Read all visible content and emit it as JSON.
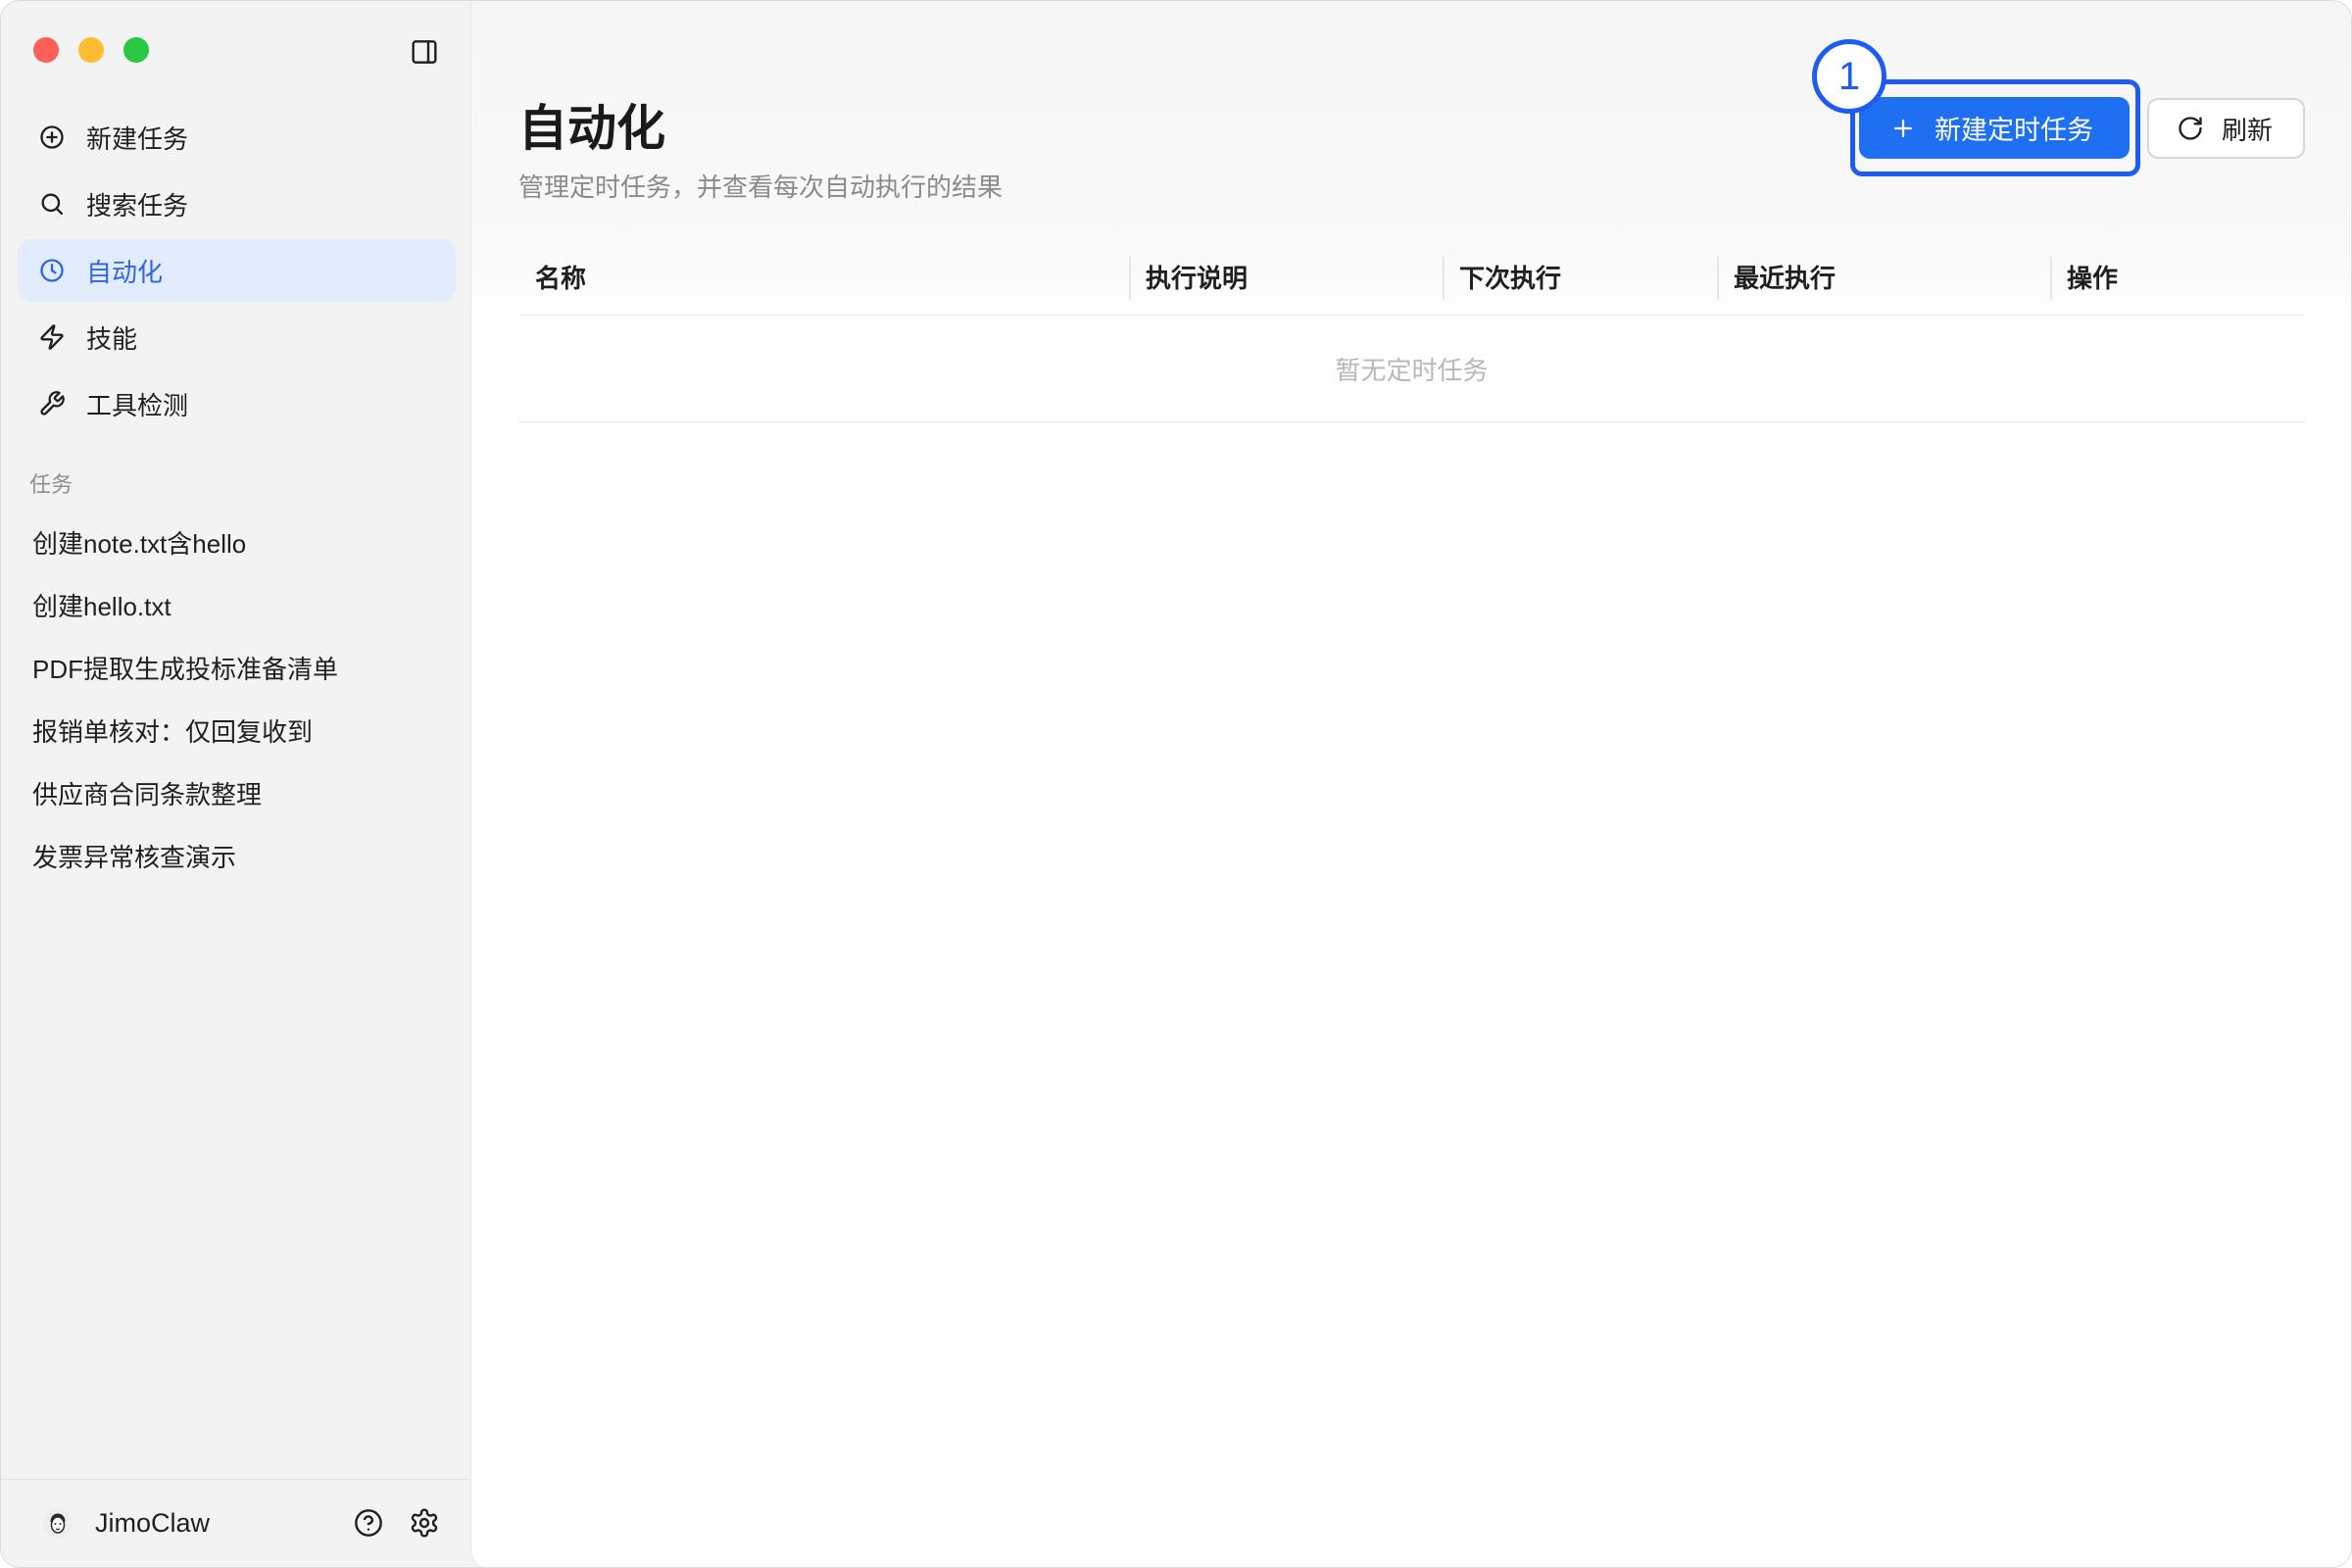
{
  "sidebar": {
    "toggle_icon": "sidebar-toggle-icon",
    "nav": [
      {
        "label": "新建任务",
        "icon": "plus-circle-icon",
        "active": false
      },
      {
        "label": "搜索任务",
        "icon": "search-icon",
        "active": false
      },
      {
        "label": "自动化",
        "icon": "clock-icon",
        "active": true
      },
      {
        "label": "技能",
        "icon": "lightning-icon",
        "active": false
      },
      {
        "label": "工具检测",
        "icon": "wrench-icon",
        "active": false
      }
    ],
    "section_label": "任务",
    "tasks": [
      "创建note.txt含hello",
      "创建hello.txt",
      "PDF提取生成投标准备清单",
      "报销单核对：仅回复收到",
      "供应商合同条款整理",
      "发票异常核查演示"
    ],
    "user": {
      "name": "JimoClaw",
      "avatar_icon": "avatar-icon"
    },
    "footer_icons": [
      "help-icon",
      "settings-icon"
    ]
  },
  "main": {
    "title": "自动化",
    "subtitle": "管理定时任务，并查看每次自动执行的结果",
    "actions": {
      "new_task_label": "新建定时任务",
      "new_task_icon": "plus-icon",
      "refresh_label": "刷新",
      "refresh_icon": "refresh-icon"
    },
    "table": {
      "columns": [
        "名称",
        "执行说明",
        "下次执行",
        "最近执行",
        "操作"
      ],
      "rows": [],
      "empty_text": "暂无定时任务"
    }
  },
  "annotation": {
    "marker_label": "1"
  },
  "colors": {
    "accent": "#1f6ff2",
    "active_nav_bg": "#e2ecfd",
    "active_nav_text": "#2b67e8",
    "annotation": "#1d5cf0",
    "traffic_close": "#ff5f57",
    "traffic_minimize": "#febc2e",
    "traffic_zoom": "#28c840"
  }
}
